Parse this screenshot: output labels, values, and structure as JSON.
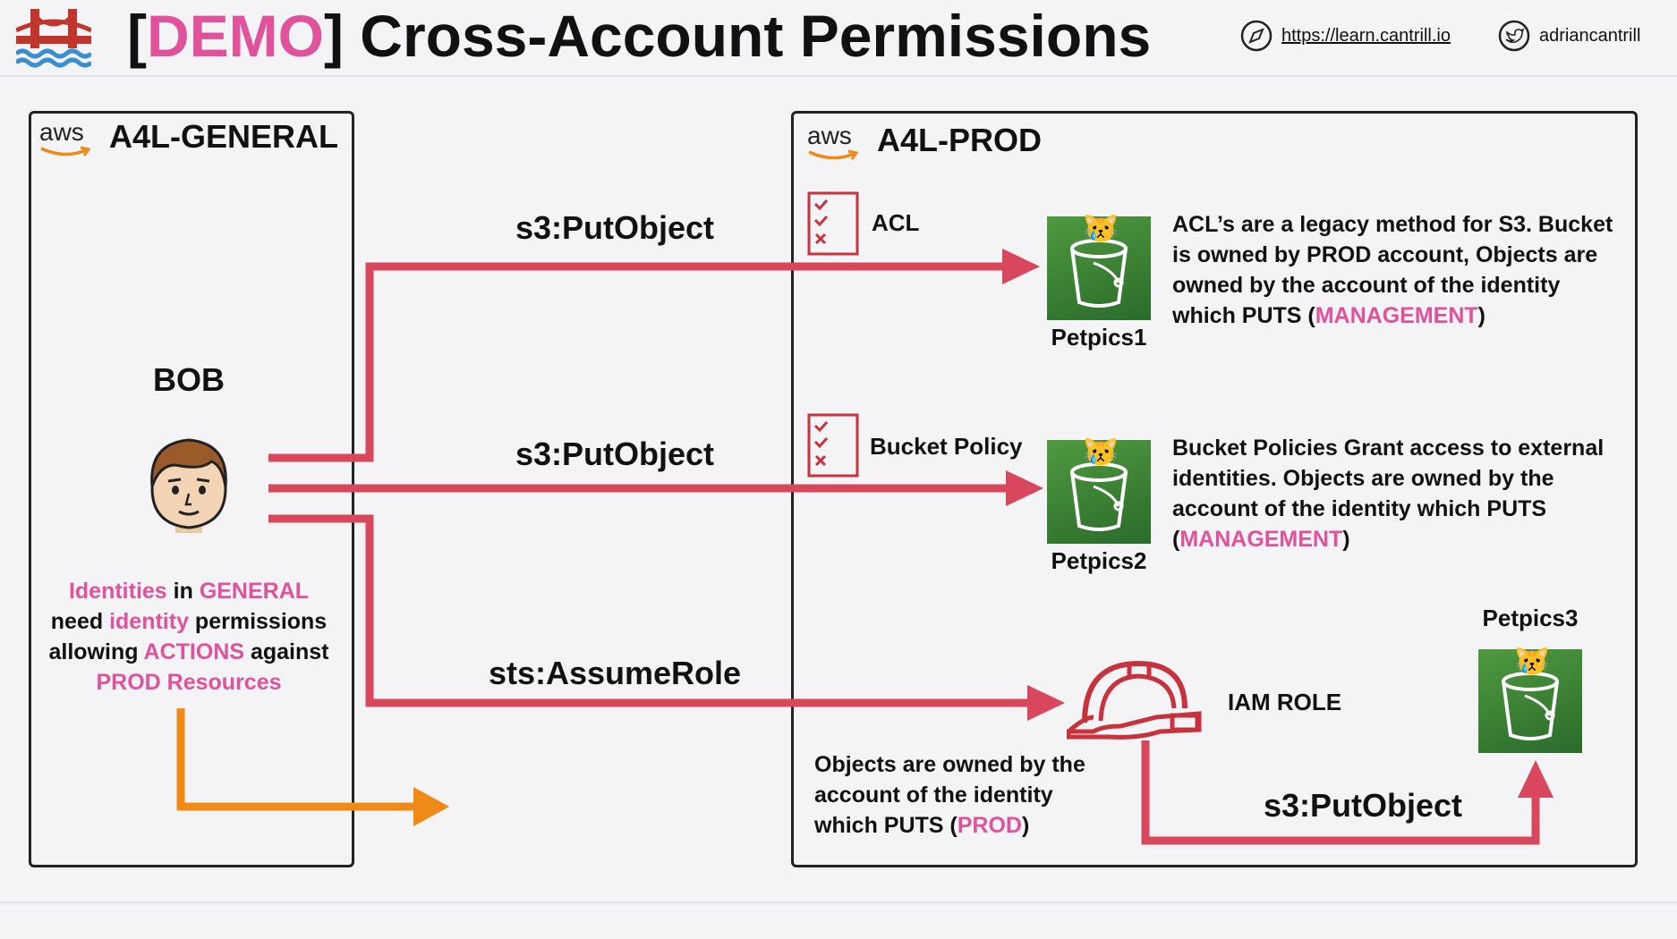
{
  "header": {
    "title_bracket_open": "[",
    "title_tag": "DEMO",
    "title_rest": "] Cross-Account Permissions",
    "url": "https://learn.cantrill.io",
    "twitter": "adriancantrill",
    "logo_icon": "golden-gate-bridge-icon",
    "url_icon": "compass-icon",
    "twitter_icon": "twitter-bird-icon"
  },
  "colors": {
    "accent_pink": "#e0529c",
    "arrow_red": "#d9475c",
    "arrow_orange": "#f08a17",
    "bucket_green": "#3a8a35",
    "helmet_red": "#c8323c"
  },
  "general_account": {
    "aws_label": "aws",
    "name": "A4L-GENERAL",
    "user_name": "BOB",
    "text_parts": [
      {
        "t": "Identities",
        "hl": true
      },
      {
        "t": " in ",
        "hl": false
      },
      {
        "t": "GENERAL",
        "hl": true
      },
      {
        "t": "need ",
        "hl": false
      },
      {
        "t": "identity",
        "hl": true
      },
      {
        "t": " permissions",
        "hl": false
      },
      {
        "t": "allowing ",
        "hl": false
      },
      {
        "t": "ACTIONS",
        "hl": true
      },
      {
        "t": " against",
        "hl": false
      },
      {
        "t": "PROD Resources",
        "hl": true
      }
    ]
  },
  "prod_account": {
    "aws_label": "aws",
    "name": "A4L-PROD",
    "acl_label": "ACL",
    "bucket_policy_label": "Bucket Policy",
    "iam_role_label": "IAM ROLE",
    "buckets": [
      "Petpics1",
      "Petpics2",
      "Petpics3"
    ],
    "acl_desc": {
      "line1": "ACL’s are a legacy method for S3. Bucket",
      "line2": "is owned by PROD account, Objects are",
      "line3": "owned by the account of the identity",
      "line4_pre": "which PUTS (",
      "line4_hl": "MANAGEMENT",
      "line4_post": ")"
    },
    "policy_desc": {
      "line1": "Bucket Policies Grant access to external",
      "line2": "identities. Objects are owned by the",
      "line3": "account of the identity which PUTS",
      "line4_pre": "(",
      "line4_hl": "MANAGEMENT",
      "line4_post": ")"
    },
    "role_desc": {
      "line1": "Objects are owned by the",
      "line2": "account of the identity",
      "line3_pre": "which PUTS (",
      "line3_hl": "PROD",
      "line3_post": ")"
    }
  },
  "arrows": {
    "top": "s3:PutObject",
    "middle": "s3:PutObject",
    "bottom": "sts:AssumeRole",
    "role_put": "s3:PutObject"
  }
}
